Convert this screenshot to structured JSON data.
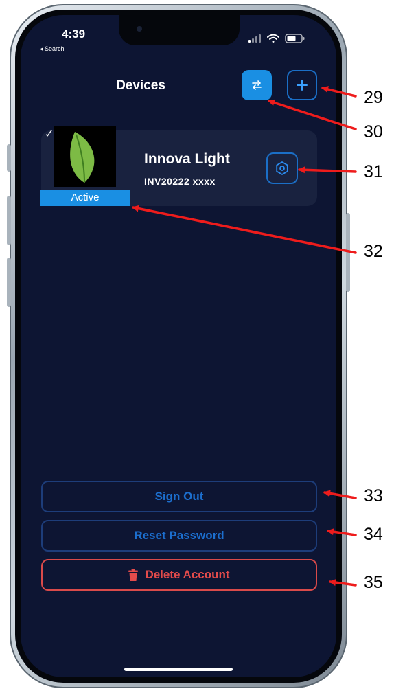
{
  "status_bar": {
    "time": "4:39",
    "back_label": "◂ Search"
  },
  "header": {
    "title": "Devices"
  },
  "device": {
    "name": "Innova Light",
    "serial": "INV20222 xxxx",
    "status": "Active"
  },
  "actions": {
    "sign_out": "Sign Out",
    "reset_password": "Reset Password",
    "delete_account": "Delete Account"
  },
  "callouts": {
    "c29": "29",
    "c30": "30",
    "c31": "31",
    "c32": "32",
    "c33": "33",
    "c34": "34",
    "c35": "35"
  },
  "colors": {
    "screen_bg": "#0d1533",
    "accent_blue": "#1a8fe3",
    "danger_red": "#e24b4b",
    "arrow_red": "#ee1c1c"
  }
}
